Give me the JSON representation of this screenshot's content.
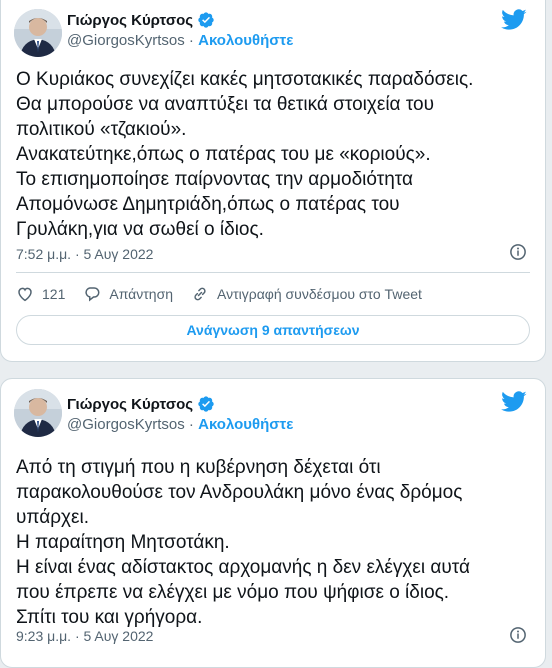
{
  "tweet1": {
    "author_name": "Γιώργος Κύρτσος",
    "handle": "@GiorgosKyrtsos",
    "separator": " · ",
    "follow_label": "Ακολουθήστε",
    "lines": [
      "Ο Κυριάκος συνεχίζει κακές μητσοτακικές παραδόσεις.",
      "Θα μπορούσε να αναπτύξει τα θετικά στοιχεία του",
      "πολιτικού «τζακιού».",
      "Ανακατεύτηκε,όπως ο πατέρας του με «κοριούς».",
      "Το επισημοποίησε παίρνοντας την αρμοδιότητα",
      "Απομόνωσε Δημητριάδη,όπως ο πατέρας του",
      "Γρυλάκη,για να σωθεί ο ίδιος."
    ],
    "timestamp": "7:52 μ.μ. · 5 Αυγ 2022",
    "like_count": "121",
    "reply_label": "Απάντηση",
    "copy_link_label": "Αντιγραφή συνδέσμου στο Tweet",
    "read_replies_label": "Ανάγνωση 9 απαντήσεων"
  },
  "tweet2": {
    "author_name": "Γιώργος Κύρτσος",
    "handle": "@GiorgosKyrtsos",
    "separator": " · ",
    "follow_label": "Ακολουθήστε",
    "lines": [
      "Από τη στιγμή που η κυβέρνηση δέχεται ότι",
      "παρακολουθούσε τον Ανδρουλάκη μόνο ένας δρόμος",
      "υπάρχει.",
      "Η παραίτηση Μητσοτάκη.",
      "Η είναι ένας αδίστακτος αρχομανής η δεν ελέγχει αυτά",
      "που έπρεπε να ελέγχει με νόμο που ψήφισε ο ίδιος.",
      "Σπίτι του και γρήγορα."
    ],
    "timestamp": "9:23 μ.μ. · 5 Αυγ 2022"
  },
  "colors": {
    "accent": "#1d9bf0",
    "text": "#0f1419",
    "muted": "#536471",
    "border": "#cfd9de"
  },
  "icons": [
    "avatar",
    "verified-badge-icon",
    "twitter-bird-icon",
    "info-icon",
    "heart-icon",
    "reply-icon",
    "link-icon"
  ]
}
